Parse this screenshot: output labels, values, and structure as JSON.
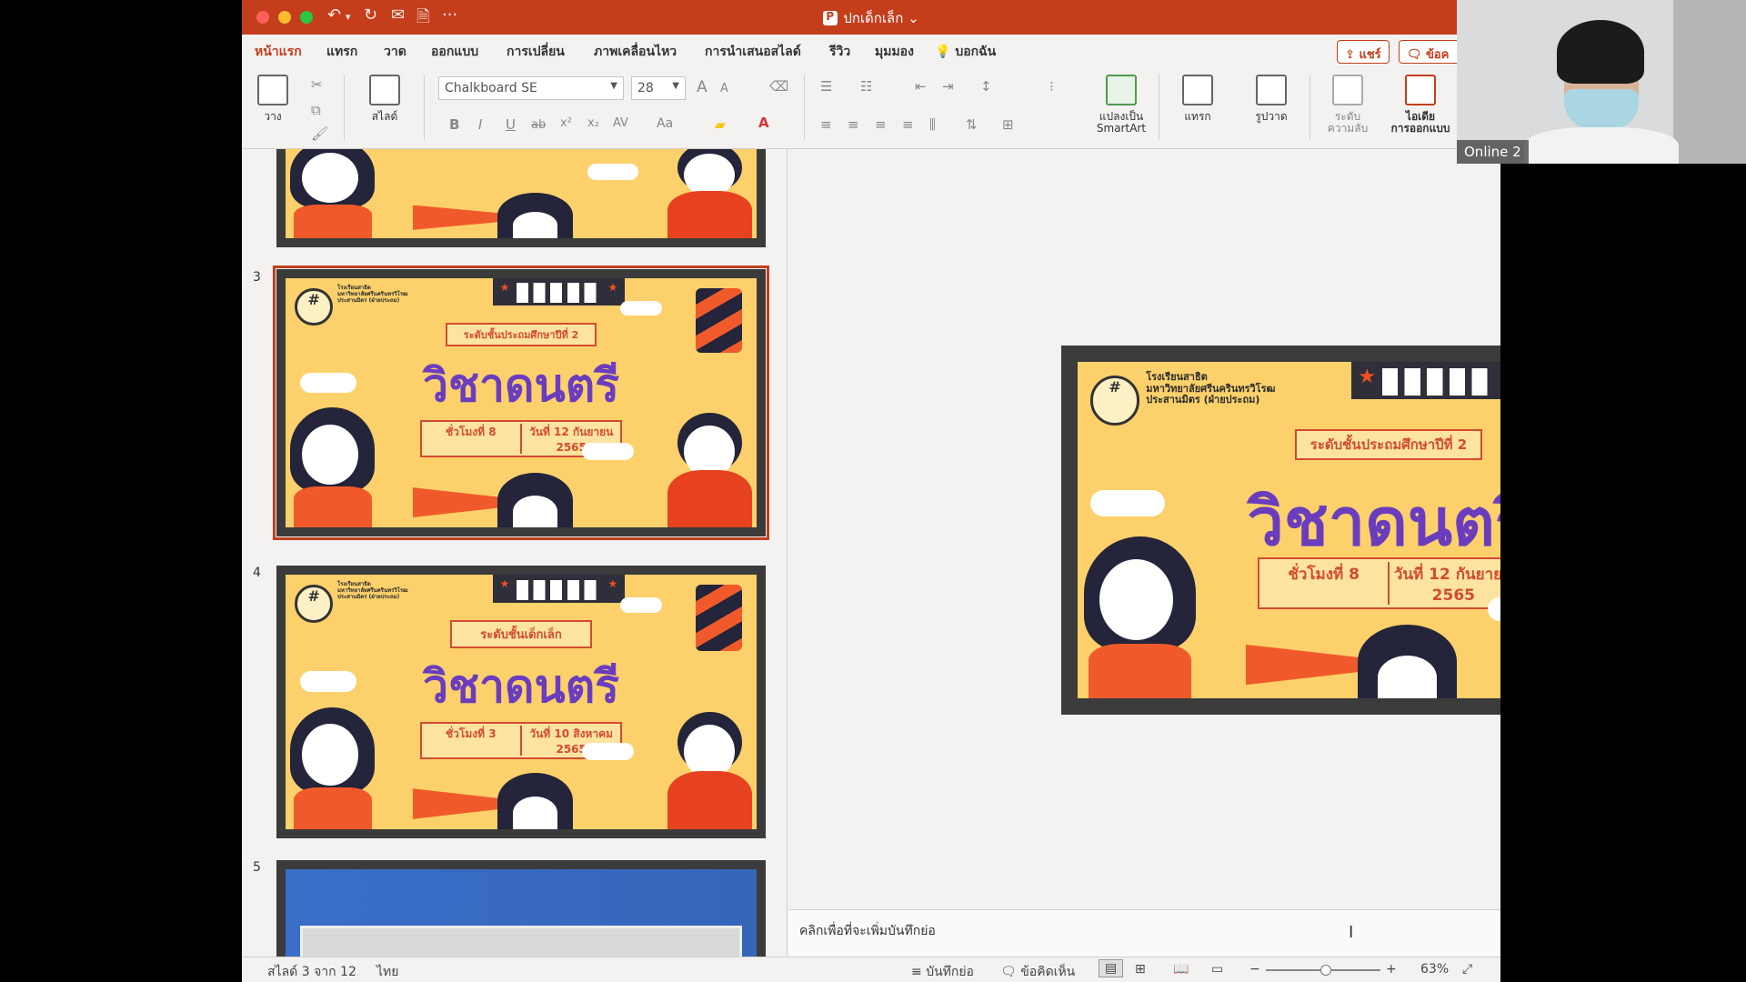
{
  "window": {
    "title": "ปกเด็กเล็ก",
    "title_chevron": "⌄",
    "undo_icon": "↶",
    "redo_icon": "↻",
    "more_icon": "···"
  },
  "tabs": [
    "หน้าแรก",
    "แทรก",
    "วาด",
    "ออกแบบ",
    "การเปลี่ยน",
    "ภาพเคลื่อนไหว",
    "การนำเสนอสไลด์",
    "รีวิว",
    "มุมมอง"
  ],
  "tell_me": "บอกฉัน",
  "share_label": "แชร์",
  "comments_label": "ข้อค",
  "ribbon": {
    "paste": "วาง",
    "slide": "สไลด์",
    "font_name": "Chalkboard SE",
    "font_size": "28",
    "grow": "A",
    "shrink": "A",
    "bold": "B",
    "italic": "I",
    "underline": "U",
    "strike": "ab",
    "superscript": "x²",
    "subscript": "x₂",
    "spacing": "AV",
    "case": "Aa",
    "convert_smartart": "แปลงเป็น\nSmartArt",
    "insert": "แทรก",
    "shapes": "รูปวาด",
    "sensitivity": "ระดับ\nความลับ",
    "designer": "ไอเดีย\nการออกแบบ"
  },
  "slides": {
    "school": "โรงเรียนสาธิต\nมหาวิทยาลัยศรีนครินทรวิโรฒ\nประสานมิตร (ฝ่ายประถม)",
    "subject": "วิชาดนตรี",
    "s3": {
      "num": "3",
      "level": "ระดับชั้นประถมศึกษาปีที่ 2",
      "hour": "ชั่วโมงที่ 8",
      "date": "วันที่ 12 กันยายน 2565"
    },
    "s4": {
      "num": "4",
      "level": "ระดับชั้นเด็กเล็ก",
      "hour": "ชั่วโมงที่ 3",
      "date": "วันที่ 10 สิงหาคม 2565"
    },
    "s5": {
      "num": "5"
    }
  },
  "notes_placeholder": "คลิกเพื่อที่จะเพิ่มบันทึกย่อ",
  "status": {
    "slide_counter": "สไลด์ 3 จาก 12",
    "language": "ไทย",
    "notes": "บันทึกย่อ",
    "comments": "ข้อคิดเห็น",
    "zoom_minus": "−",
    "zoom_plus": "+",
    "zoom": "63%",
    "zoom_level": 0.52
  },
  "webcam": {
    "label": "Online 2"
  },
  "colors": {
    "accent": "#c43e1c",
    "subject": "#6a3dbf",
    "slide_bg": "#fcd16b"
  }
}
